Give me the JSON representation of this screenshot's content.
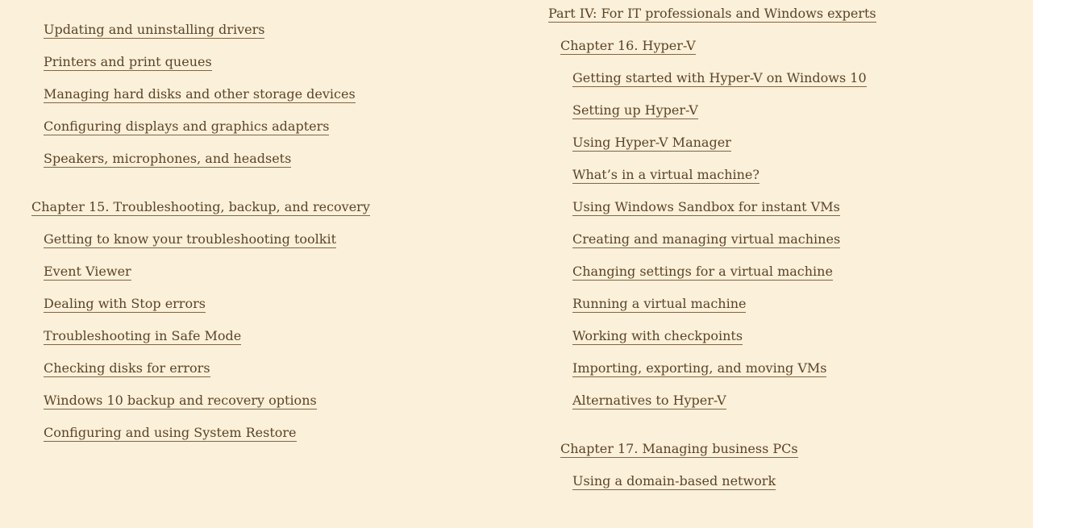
{
  "left_column": {
    "items": [
      {
        "label": "Updating and uninstalling drivers"
      },
      {
        "label": "Printers and print queues"
      },
      {
        "label": "Managing hard disks and other storage devices"
      },
      {
        "label": "Configuring displays and graphics adapters"
      },
      {
        "label": "Speakers, microphones, and headsets"
      },
      {
        "label": "Chapter 15. Troubleshooting, backup, and recovery"
      },
      {
        "label": "Getting to know your troubleshooting toolkit"
      },
      {
        "label": "Event Viewer"
      },
      {
        "label": "Dealing with Stop errors"
      },
      {
        "label": "Troubleshooting in Safe Mode"
      },
      {
        "label": "Checking disks for errors"
      },
      {
        "label": "Windows 10 backup and recovery options"
      },
      {
        "label": "Configuring and using System Restore"
      }
    ]
  },
  "right_column": {
    "items": [
      {
        "label": "Part IV: For IT professionals and Windows experts"
      },
      {
        "label": "Chapter 16. Hyper-V"
      },
      {
        "label": "Getting started with Hyper-V on Windows 10"
      },
      {
        "label": "Setting up Hyper-V"
      },
      {
        "label": "Using Hyper-V Manager"
      },
      {
        "label": "What’s in a virtual machine?"
      },
      {
        "label": "Using Windows Sandbox for instant VMs"
      },
      {
        "label": "Creating and managing virtual machines"
      },
      {
        "label": "Changing settings for a virtual machine"
      },
      {
        "label": "Running a virtual machine"
      },
      {
        "label": "Working with checkpoints"
      },
      {
        "label": "Importing, exporting, and moving VMs"
      },
      {
        "label": "Alternatives to Hyper-V"
      },
      {
        "label": "Chapter 17. Managing business PCs"
      },
      {
        "label": "Using a domain-based network"
      }
    ]
  },
  "colors": {
    "page_background": "#fbf0d9",
    "link_text": "#5a4428"
  }
}
